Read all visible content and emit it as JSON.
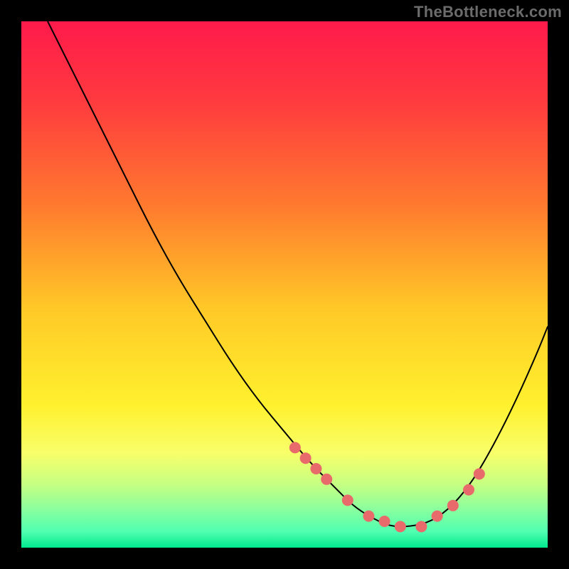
{
  "watermark": "TheBottleneck.com",
  "chart_data": {
    "type": "line",
    "title": "",
    "xlabel": "",
    "ylabel": "",
    "xlim": [
      0,
      100
    ],
    "ylim": [
      0,
      100
    ],
    "grid": false,
    "legend": false,
    "gradient_stops": [
      {
        "offset": 0.0,
        "color": "#ff1a4b"
      },
      {
        "offset": 0.15,
        "color": "#ff3a3f"
      },
      {
        "offset": 0.35,
        "color": "#ff7a2e"
      },
      {
        "offset": 0.55,
        "color": "#ffca27"
      },
      {
        "offset": 0.73,
        "color": "#fff12e"
      },
      {
        "offset": 0.82,
        "color": "#f8ff6a"
      },
      {
        "offset": 0.88,
        "color": "#c6ff82"
      },
      {
        "offset": 0.93,
        "color": "#86ffa0"
      },
      {
        "offset": 0.97,
        "color": "#4fffb0"
      },
      {
        "offset": 1.0,
        "color": "#00e98e"
      }
    ],
    "series": [
      {
        "name": "curve",
        "color": "#000000",
        "stroke_width": 2,
        "x": [
          5,
          10,
          15,
          20,
          25,
          30,
          35,
          40,
          45,
          50,
          55,
          60,
          63,
          66,
          70,
          74,
          78,
          82,
          86,
          90,
          94,
          98,
          100
        ],
        "y": [
          100,
          90,
          80,
          70,
          60,
          51,
          43,
          35,
          28,
          22,
          16,
          11,
          8,
          6,
          4,
          4,
          5,
          8,
          13,
          20,
          28,
          37,
          42
        ]
      }
    ],
    "markers": {
      "name": "dots",
      "color": "#e96a6a",
      "radius": 8,
      "x": [
        52,
        54,
        56,
        58,
        62,
        66,
        69,
        72,
        76,
        79,
        82,
        85,
        87
      ],
      "y": [
        19,
        17,
        15,
        13,
        9,
        6,
        5,
        4,
        4,
        6,
        8,
        11,
        14
      ]
    }
  }
}
